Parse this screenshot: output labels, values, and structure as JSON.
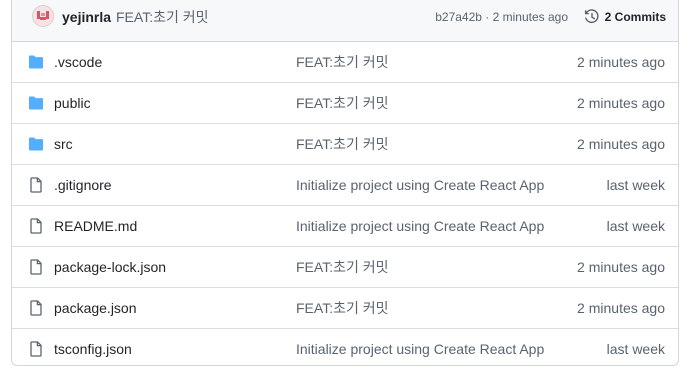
{
  "latest_commit": {
    "author": "yejinrla",
    "message": "FEAT:초기 커밋",
    "meta": "b27a42b · 2 minutes ago",
    "commits_label": "2 Commits"
  },
  "files": [
    {
      "name": ".vscode",
      "type": "folder",
      "message": "FEAT:초기 커밋",
      "time": "2 minutes ago"
    },
    {
      "name": "public",
      "type": "folder",
      "message": "FEAT:초기 커밋",
      "time": "2 minutes ago"
    },
    {
      "name": "src",
      "type": "folder",
      "message": "FEAT:초기 커밋",
      "time": "2 minutes ago"
    },
    {
      "name": ".gitignore",
      "type": "file",
      "message": "Initialize project using Create React App",
      "time": "last week"
    },
    {
      "name": "README.md",
      "type": "file",
      "message": "Initialize project using Create React App",
      "time": "last week"
    },
    {
      "name": "package-lock.json",
      "type": "file",
      "message": "FEAT:초기 커밋",
      "time": "2 minutes ago"
    },
    {
      "name": "package.json",
      "type": "file",
      "message": "FEAT:초기 커밋",
      "time": "2 minutes ago"
    },
    {
      "name": "tsconfig.json",
      "type": "file",
      "message": "Initialize project using Create React App",
      "time": "last week"
    }
  ],
  "icons": {
    "folder": "folder-icon",
    "file": "file-icon",
    "history": "history-icon"
  },
  "colors": {
    "folder": "#54aeff",
    "file_outline": "#59636e",
    "avatar": "#d9546a"
  }
}
